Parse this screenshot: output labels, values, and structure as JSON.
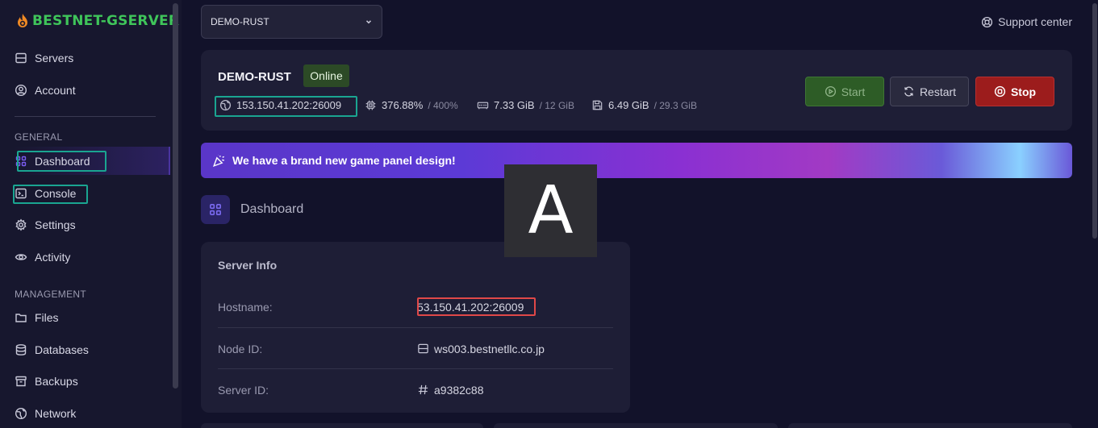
{
  "sidebar": {
    "brand": "BESTNET-GSERVER",
    "top_items": [
      {
        "label": "Servers",
        "icon": "server-icon"
      },
      {
        "label": "Account",
        "icon": "user-circle-icon"
      }
    ],
    "general_label": "GENERAL",
    "general_items": [
      {
        "label": "Dashboard",
        "icon": "grid-icon"
      },
      {
        "label": "Console",
        "icon": "terminal-icon"
      },
      {
        "label": "Settings",
        "icon": "gear-icon"
      },
      {
        "label": "Activity",
        "icon": "eye-icon"
      }
    ],
    "management_label": "MANAGEMENT",
    "management_items": [
      {
        "label": "Files",
        "icon": "folder-icon"
      },
      {
        "label": "Databases",
        "icon": "database-icon"
      },
      {
        "label": "Backups",
        "icon": "archive-icon"
      },
      {
        "label": "Network",
        "icon": "globe-icon"
      }
    ]
  },
  "header": {
    "server_select": "DEMO-RUST",
    "support_label": "Support center"
  },
  "server": {
    "name": "DEMO-RUST",
    "status": "Online",
    "address": "153.150.41.202:26009",
    "cpu": "376.88%",
    "cpu_limit": "/ 400%",
    "memory": "7.33 GiB",
    "memory_limit": "/ 12 GiB",
    "disk": "6.49 GiB",
    "disk_limit": "/ 29.3 GiB",
    "start_label": "Start",
    "restart_label": "Restart",
    "stop_label": "Stop"
  },
  "banner": {
    "text": "We have a brand new game panel design!"
  },
  "dashboard": {
    "title": "Dashboard"
  },
  "server_info": {
    "title": "Server Info",
    "rows": [
      {
        "label": "Hostname:",
        "value": "53.150.41.202:26009"
      },
      {
        "label": "Node ID:",
        "value": "ws003.bestnetllc.co.jp"
      },
      {
        "label": "Server ID:",
        "value": "a9382c88"
      }
    ]
  },
  "overlay": {
    "letter": "A"
  },
  "colors": {
    "brand": "#3fc55a",
    "online": "#2c4a26",
    "stop": "#9c1c1c",
    "highlight_teal": "#1aa591",
    "highlight_red": "#e04848"
  }
}
